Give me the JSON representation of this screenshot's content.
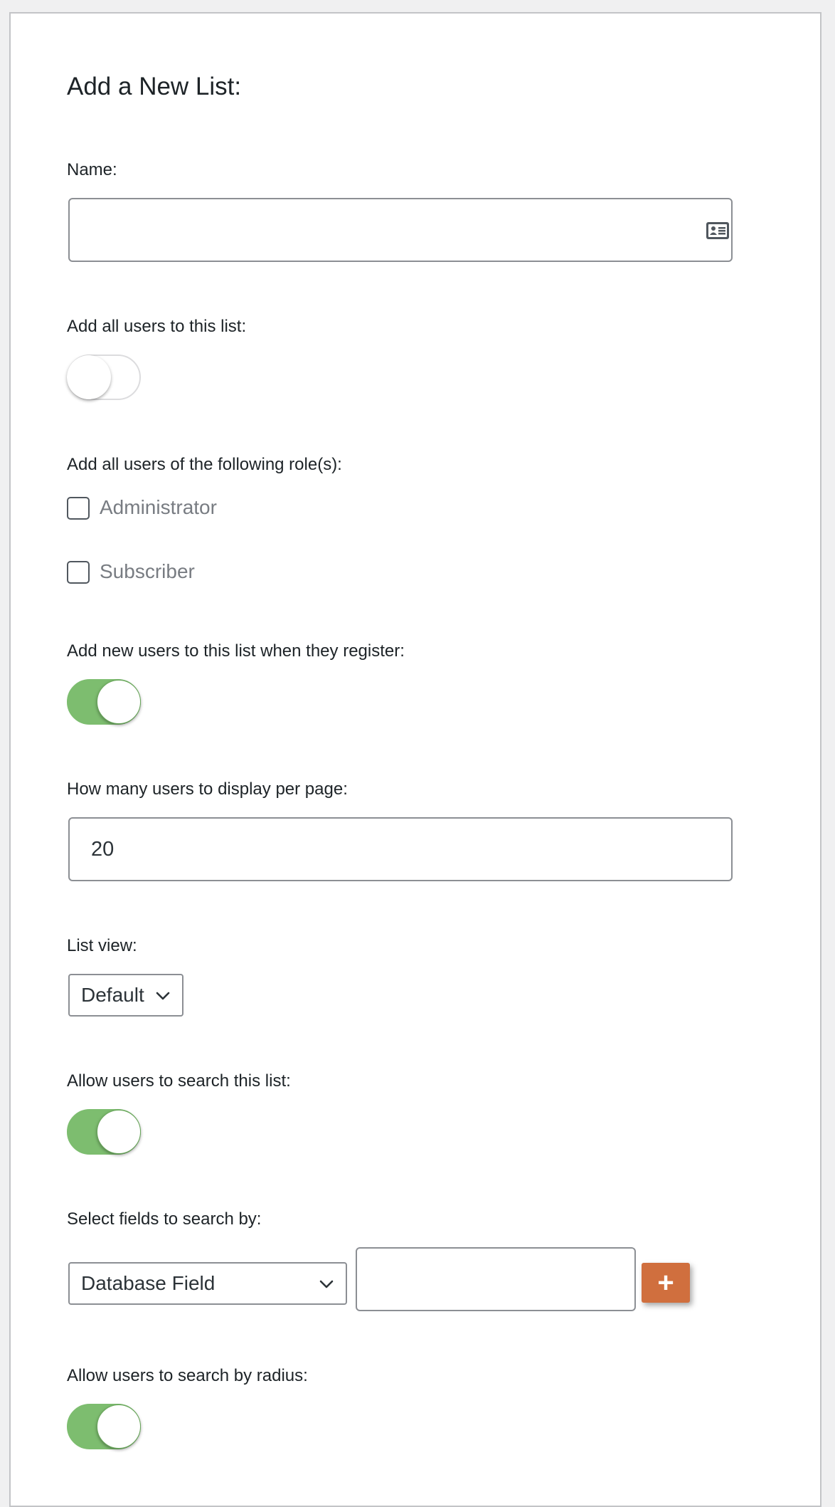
{
  "form": {
    "heading": "Add a New List:",
    "name": {
      "label": "Name:",
      "value": "",
      "placeholder": ""
    },
    "add_all_users": {
      "label": "Add all users to this list:",
      "enabled": false
    },
    "roles": {
      "label": "Add all users of the following role(s):",
      "options": [
        {
          "label": "Administrator",
          "checked": false
        },
        {
          "label": "Subscriber",
          "checked": false
        }
      ]
    },
    "add_new_users": {
      "label": "Add new users to this list when they register:",
      "enabled": true
    },
    "per_page": {
      "label": "How many users to display per page:",
      "value": "20"
    },
    "list_view": {
      "label": "List view:",
      "selected": "Default"
    },
    "allow_search": {
      "label": "Allow users to search this list:",
      "enabled": true
    },
    "search_fields": {
      "label": "Select fields to search by:",
      "selected": "Database Field",
      "value": "",
      "add_button": "+"
    },
    "search_radius": {
      "label": "Allow users to search by radius:",
      "enabled": true
    }
  },
  "colors": {
    "toggle_on": "#7dbd6f",
    "add_button": "#d06f3e",
    "page_background": "#f0f0f1"
  },
  "icons": {
    "name_field_icon": "contact-card-icon",
    "select_arrow": "chevron-down-icon"
  }
}
